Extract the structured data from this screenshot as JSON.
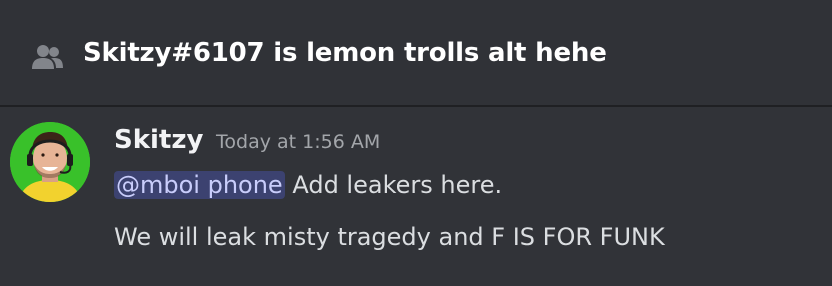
{
  "channel": {
    "icon": "members-icon",
    "title": "Skitzy#6107 is lemon trolls alt hehe"
  },
  "message": {
    "author": "Skitzy",
    "timestamp": "Today at 1:56 AM",
    "avatar_icon": "user-avatar",
    "line1": {
      "mention": "@mboi phone",
      "text": " Add leakers here."
    },
    "line2": "We will leak misty tragedy and F IS FOR FUNK"
  },
  "colors": {
    "background": "#313338",
    "mention_bg": "#3c4270",
    "mention_text": "#c9cdfb",
    "avatar_bg": "#39c12a"
  }
}
